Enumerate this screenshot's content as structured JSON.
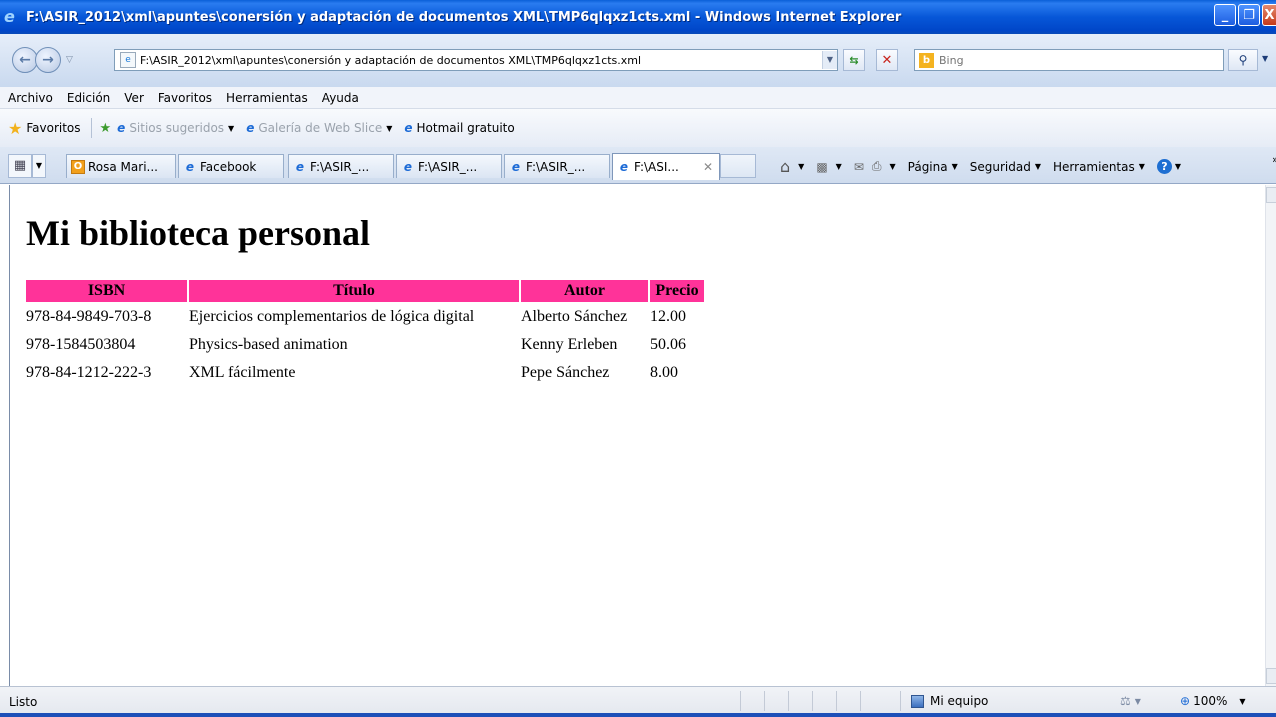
{
  "window": {
    "title": "F:\\ASIR_2012\\xml\\apuntes\\conersión y adaptación de documentos XML\\TMP6qlqxz1cts.xml - Windows Internet Explorer",
    "min_glyph": "_",
    "max_glyph": "❐",
    "close_glyph": "X"
  },
  "address": {
    "url": "F:\\ASIR_2012\\xml\\apuntes\\conersión y adaptación de documentos XML\\TMP6qlqxz1cts.xml",
    "search_placeholder": "Bing"
  },
  "menu": [
    "Archivo",
    "Edición",
    "Ver",
    "Favoritos",
    "Herramientas",
    "Ayuda"
  ],
  "favorites_bar": {
    "label": "Favoritos",
    "items": [
      "Sitios sugeridos",
      "Galería de Web Slice",
      "Hotmail gratuito"
    ]
  },
  "tabs": [
    {
      "label": "Rosa Mari..."
    },
    {
      "label": "Facebook"
    },
    {
      "label": "F:\\ASIR_..."
    },
    {
      "label": "F:\\ASIR_..."
    },
    {
      "label": "F:\\ASIR_..."
    },
    {
      "label": "F:\\ASI..."
    }
  ],
  "command_bar": {
    "page": "Página",
    "safety": "Seguridad",
    "tools": "Herramientas"
  },
  "page": {
    "heading": "Mi biblioteca personal",
    "columns": [
      "ISBN",
      "Título",
      "Autor",
      "Precio"
    ],
    "rows": [
      {
        "isbn": "978-84-9849-703-8",
        "title": "Ejercicios complementarios de lógica digital",
        "author": "Alberto Sánchez",
        "price": "12.00"
      },
      {
        "isbn": "978-1584503804",
        "title": "Physics-based animation",
        "author": "Kenny Erleben",
        "price": "50.06"
      },
      {
        "isbn": "978-84-1212-222-3",
        "title": "XML fácilmente",
        "author": "Pepe Sánchez",
        "price": "8.00"
      }
    ],
    "header_color": "#ff3399"
  },
  "status": {
    "text": "Listo",
    "zone": "Mi equipo",
    "zoom": "100%"
  }
}
